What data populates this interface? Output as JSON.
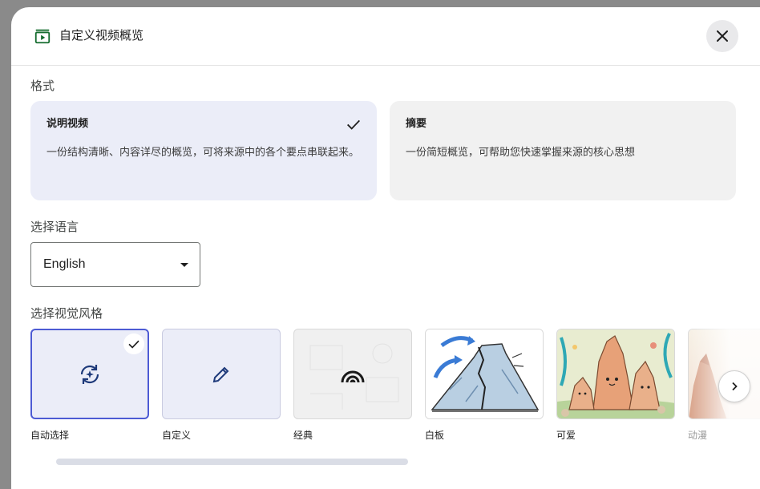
{
  "dialog": {
    "title": "自定义视频概览",
    "header_icon": "video-overview-icon",
    "close_icon": "close-icon"
  },
  "format": {
    "label": "格式",
    "options": [
      {
        "title": "说明视频",
        "desc": "一份结构清晰、内容详尽的概览，可将来源中的各个要点串联起来。",
        "selected": true
      },
      {
        "title": "摘要",
        "desc": "一份简短概览，可帮助您快速掌握来源的核心思想",
        "selected": false
      }
    ]
  },
  "language": {
    "label": "选择语言",
    "value": "English",
    "caret_icon": "dropdown-caret-icon"
  },
  "visual_style": {
    "label": "选择视觉风格",
    "options": [
      {
        "label": "自动选择",
        "icon": "auto-select-icon",
        "selected": true
      },
      {
        "label": "自定义",
        "icon": "pencil-icon",
        "selected": false
      },
      {
        "label": "经典",
        "icon": "classic-rainbow-icon",
        "selected": false
      },
      {
        "label": "白板",
        "icon": "whiteboard-image",
        "selected": false
      },
      {
        "label": "可爱",
        "icon": "kawaii-image",
        "selected": false
      },
      {
        "label": "动漫",
        "icon": "anime-image",
        "selected": false
      }
    ],
    "next_icon": "chevron-right-icon"
  },
  "colors": {
    "accent": "#4d5bd4",
    "selected_bg": "#ebedf8",
    "icon_green": "#146c2e"
  }
}
